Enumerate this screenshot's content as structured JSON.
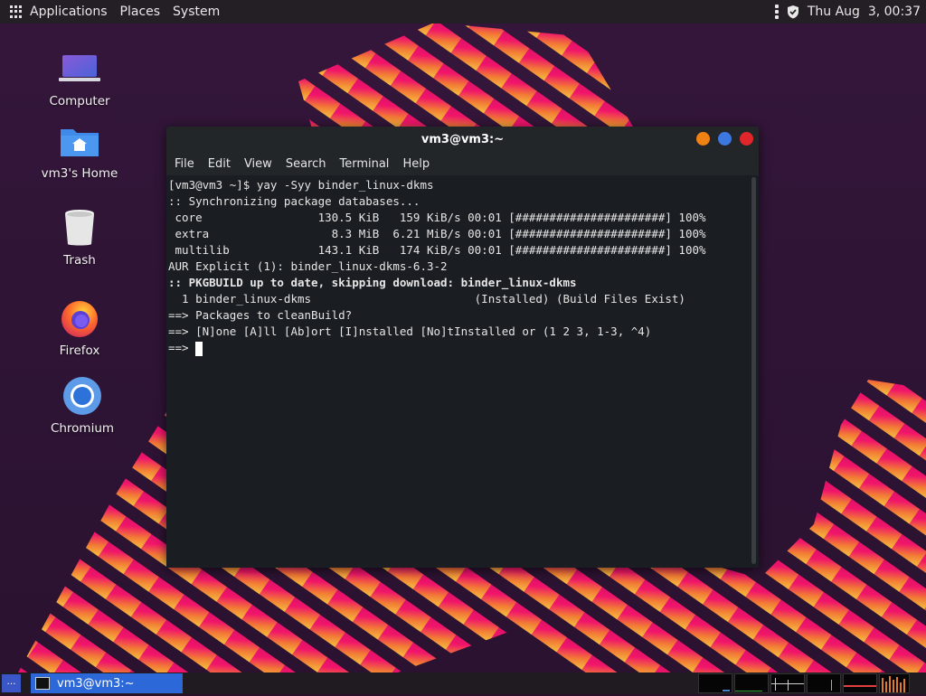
{
  "top_panel": {
    "menus": [
      "Applications",
      "Places",
      "System"
    ],
    "clock": "Thu Aug  3, 00:37"
  },
  "desktop_icons": [
    {
      "label": "Computer",
      "icon": "computer-icon"
    },
    {
      "label": "vm3's Home",
      "icon": "home-folder-icon"
    },
    {
      "label": "Trash",
      "icon": "trash-icon"
    },
    {
      "label": "Firefox",
      "icon": "firefox-icon"
    },
    {
      "label": "Chromium",
      "icon": "chromium-icon"
    }
  ],
  "terminal": {
    "title": "vm3@vm3:~",
    "menu": [
      "File",
      "Edit",
      "View",
      "Search",
      "Terminal",
      "Help"
    ],
    "lines": [
      "[vm3@vm3 ~]$ yay -Syy binder_linux-dkms",
      ":: Synchronizing package databases...",
      " core                 130.5 KiB   159 KiB/s 00:01 [######################] 100%",
      " extra                  8.3 MiB  6.21 MiB/s 00:01 [######################] 100%",
      " multilib             143.1 KiB   174 KiB/s 00:01 [######################] 100%",
      "AUR Explicit (1): binder_linux-dkms-6.3-2",
      ":: PKGBUILD up to date, skipping download: binder_linux-dkms",
      "  1 binder_linux-dkms                        (Installed) (Build Files Exist)",
      "==> Packages to cleanBuild?",
      "==> [N]one [A]ll [Ab]ort [I]nstalled [No]tInstalled or (1 2 3, 1-3, ^4)",
      "==> "
    ]
  },
  "taskbar": {
    "task_label": "vm3@vm3:~"
  },
  "colors": {
    "close": "#e0262b",
    "maximize": "#3c78e0",
    "minimize": "#ef8212",
    "task_active": "#2d68d8",
    "wallpaper_pink": "#f0156a",
    "wallpaper_orange": "#f58a3a"
  }
}
